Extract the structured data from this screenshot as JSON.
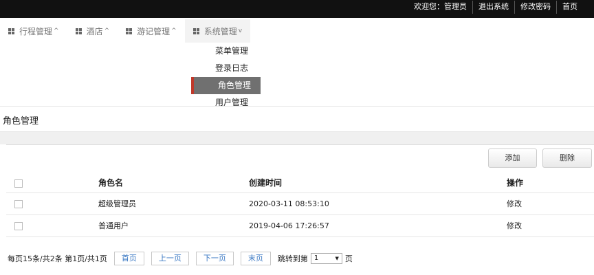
{
  "topbar": {
    "welcome": "欢迎您：管理员",
    "logout": "退出系统",
    "change_password": "修改密码",
    "home": "首页"
  },
  "nav": [
    {
      "label": "行程管理",
      "chevron": "^"
    },
    {
      "label": "酒店",
      "chevron": "^"
    },
    {
      "label": "游记管理",
      "chevron": "^"
    },
    {
      "label": "系统管理",
      "chevron": "v"
    }
  ],
  "dropdown": [
    "菜单管理",
    "登录日志",
    "角色管理",
    "用户管理"
  ],
  "page_title": "角色管理",
  "actions": {
    "add": "添加",
    "delete": "删除"
  },
  "table": {
    "headers": {
      "name": "角色名",
      "time": "创建时间",
      "op": "操作"
    },
    "rows": [
      {
        "name": "超级管理员",
        "time": "2020-03-11 08:53:10",
        "op": "修改"
      },
      {
        "name": "普通用户",
        "time": "2019-04-06 17:26:57",
        "op": "修改"
      }
    ]
  },
  "pager": {
    "summary": "每页15条/共2条 第1页/共1页",
    "first": "首页",
    "prev": "上一页",
    "next": "下一页",
    "last": "末页",
    "jump_prefix": "跳转到第",
    "page_value": "1",
    "jump_suffix": "页"
  },
  "colors": {
    "topbar": "#111111",
    "active_marker": "#c0392b",
    "dropdown_active": "#707070",
    "pager_link": "#3a78c3"
  }
}
